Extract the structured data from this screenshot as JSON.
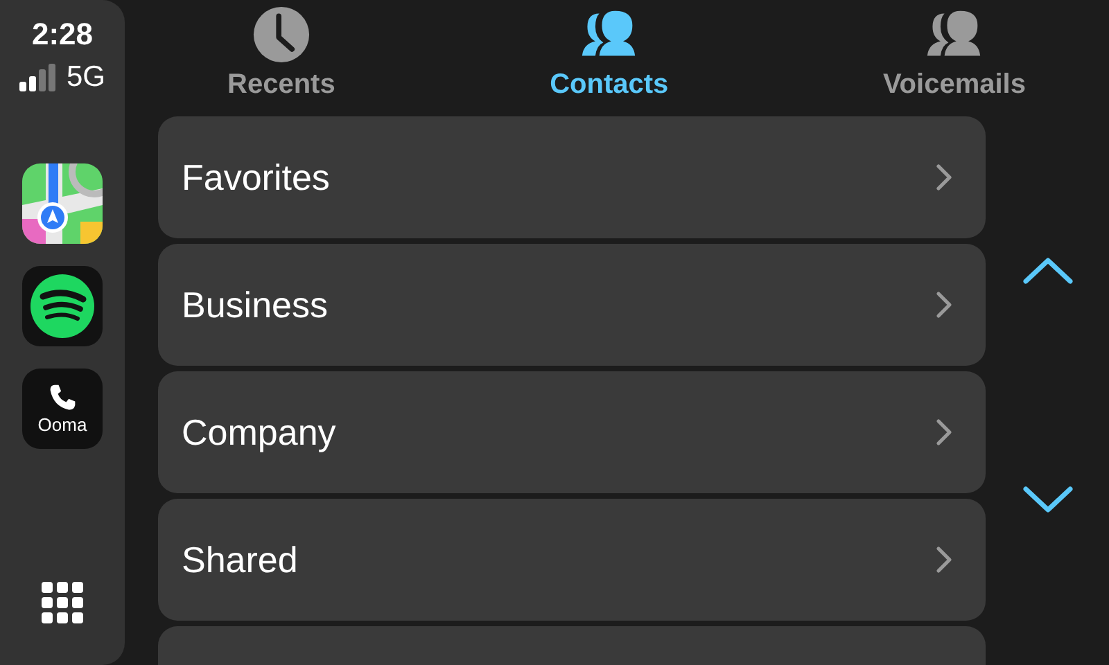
{
  "status": {
    "time": "2:28",
    "network": "5G"
  },
  "dock": [
    {
      "kind": "maps"
    },
    {
      "kind": "spotify"
    },
    {
      "kind": "ooma",
      "label": "Ooma"
    }
  ],
  "tabs": [
    {
      "label": "Recents",
      "kind": "clock",
      "selected": false
    },
    {
      "label": "Contacts",
      "kind": "people",
      "selected": true
    },
    {
      "label": "Voicemails",
      "kind": "people",
      "selected": false
    }
  ],
  "groups": [
    {
      "label": "Favorites"
    },
    {
      "label": "Business"
    },
    {
      "label": "Company"
    },
    {
      "label": "Shared"
    }
  ]
}
